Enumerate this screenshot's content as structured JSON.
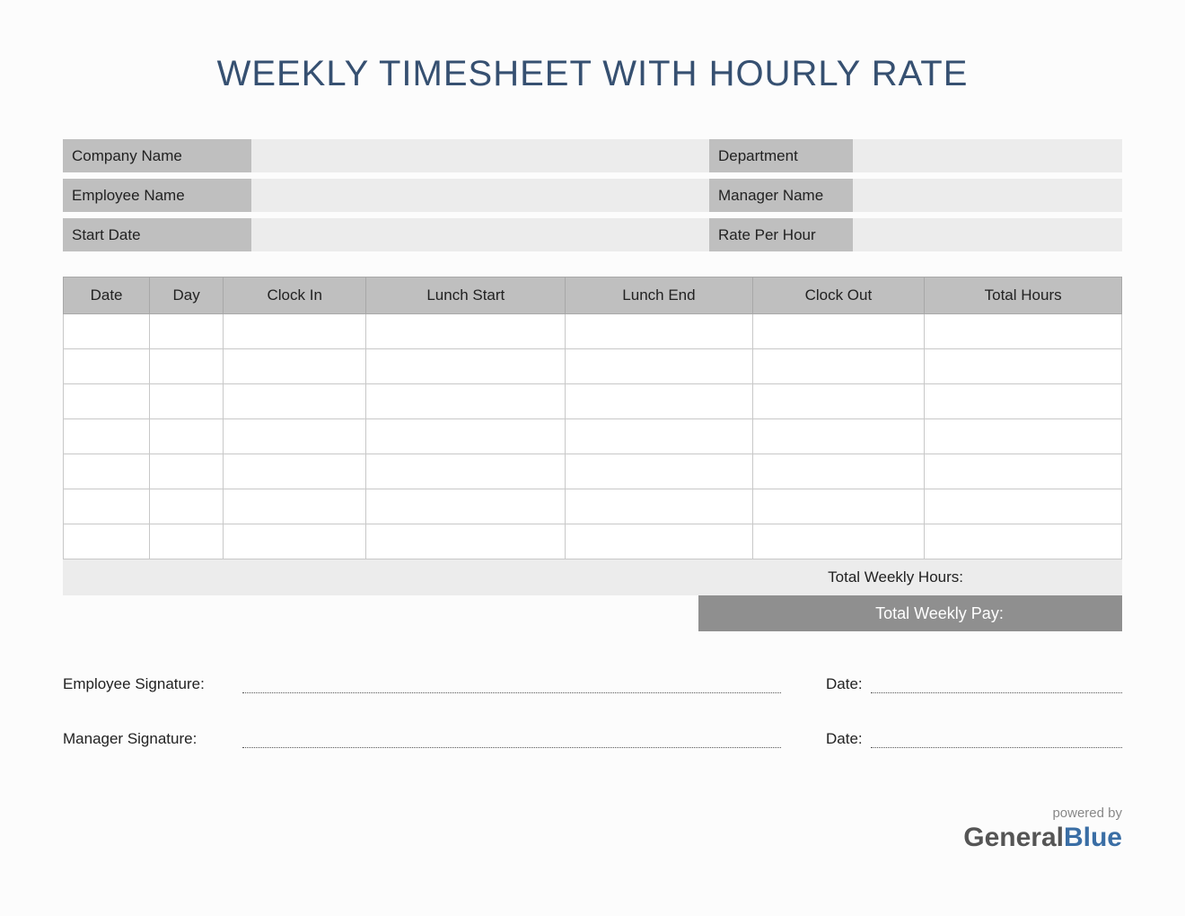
{
  "title": "WEEKLY TIMESHEET WITH HOURLY RATE",
  "info": {
    "company_label": "Company Name",
    "department_label": "Department",
    "employee_label": "Employee Name",
    "manager_label": "Manager Name",
    "start_date_label": "Start Date",
    "rate_label": "Rate Per Hour"
  },
  "table": {
    "headers": [
      "Date",
      "Day",
      "Clock In",
      "Lunch Start",
      "Lunch End",
      "Clock Out",
      "Total Hours"
    ],
    "rows": [
      [
        "",
        "",
        "",
        "",
        "",
        "",
        ""
      ],
      [
        "",
        "",
        "",
        "",
        "",
        "",
        ""
      ],
      [
        "",
        "",
        "",
        "",
        "",
        "",
        ""
      ],
      [
        "",
        "",
        "",
        "",
        "",
        "",
        ""
      ],
      [
        "",
        "",
        "",
        "",
        "",
        "",
        ""
      ],
      [
        "",
        "",
        "",
        "",
        "",
        "",
        ""
      ],
      [
        "",
        "",
        "",
        "",
        "",
        "",
        ""
      ]
    ]
  },
  "totals": {
    "weekly_hours_label": "Total Weekly Hours:",
    "weekly_pay_label": "Total Weekly Pay:"
  },
  "signatures": {
    "employee_label": "Employee Signature:",
    "manager_label": "Manager Signature:",
    "date_label": "Date:"
  },
  "footer": {
    "powered": "powered by",
    "brand_g": "General",
    "brand_b": "Blue"
  }
}
